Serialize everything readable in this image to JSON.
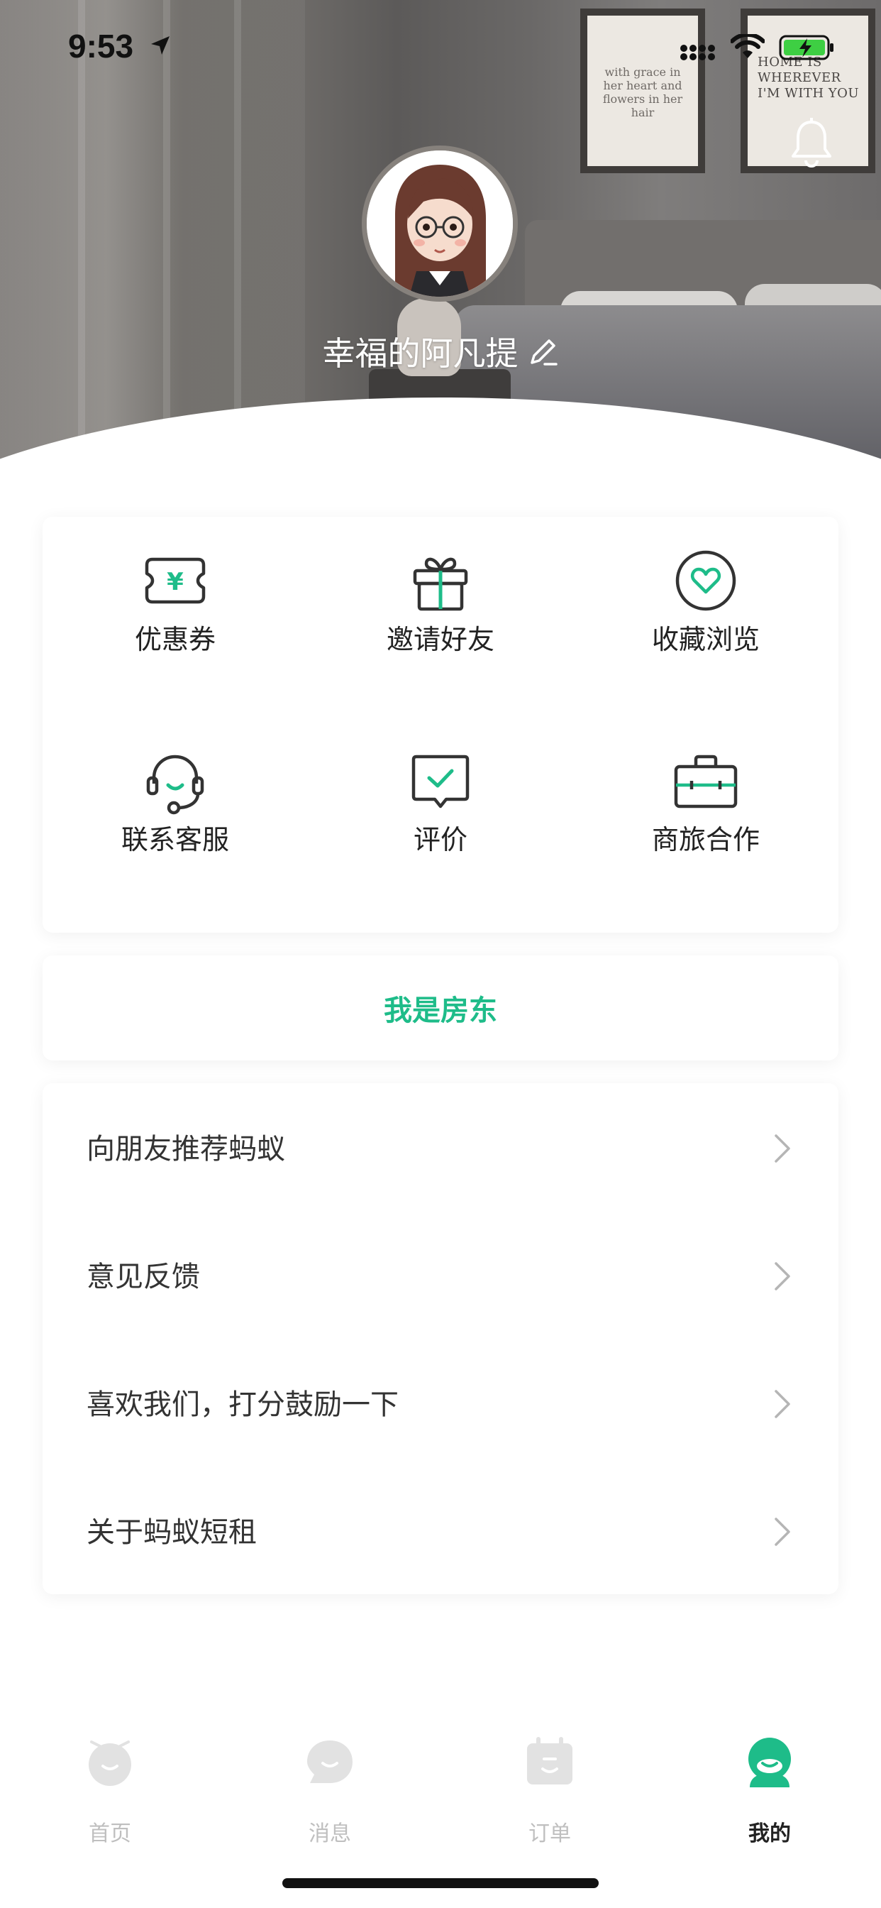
{
  "status_bar": {
    "time": "9:53"
  },
  "header": {
    "username": "幸福的阿凡提",
    "frame_left_text": "with grace in her heart and flowers in her hair",
    "frame_right_text": "HOME IS WHEREVER I'M WITH YOU"
  },
  "services": [
    {
      "label": "优惠券",
      "icon": "coupon-icon"
    },
    {
      "label": "邀请好友",
      "icon": "gift-icon"
    },
    {
      "label": "收藏浏览",
      "icon": "heart-icon"
    },
    {
      "label": "联系客服",
      "icon": "headset-icon"
    },
    {
      "label": "评价",
      "icon": "review-icon"
    },
    {
      "label": "商旅合作",
      "icon": "briefcase-icon"
    }
  ],
  "landlord_label": "我是房东",
  "menu": [
    {
      "label": "向朋友推荐蚂蚁"
    },
    {
      "label": "意见反馈"
    },
    {
      "label": "喜欢我们，打分鼓励一下"
    },
    {
      "label": "关于蚂蚁短租"
    }
  ],
  "tabs": [
    {
      "label": "首页",
      "icon": "home-tab-icon",
      "active": false
    },
    {
      "label": "消息",
      "icon": "message-tab-icon",
      "active": false
    },
    {
      "label": "订单",
      "icon": "order-tab-icon",
      "active": false
    },
    {
      "label": "我的",
      "icon": "profile-tab-icon",
      "active": true
    }
  ],
  "colors": {
    "accent": "#1ebc89",
    "icon_stroke": "#333333",
    "inactive": "#bfbfbf"
  }
}
